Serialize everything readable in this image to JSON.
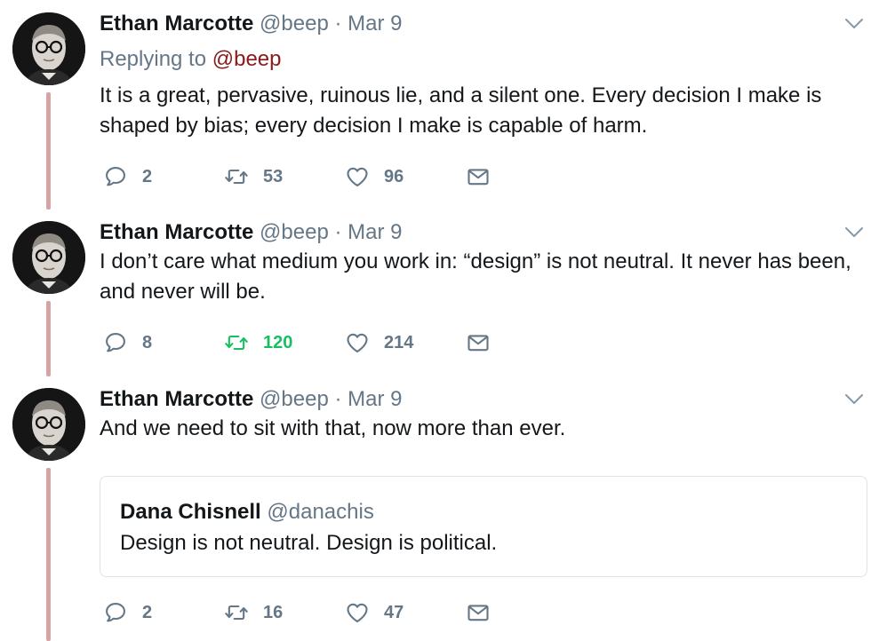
{
  "colors": {
    "text": "#14171a",
    "muted": "#657786",
    "mention": "#8b1a1a",
    "retweet_active": "#17bf63",
    "thread_line": "#d7a4a6",
    "quote_border": "#dfe3e8"
  },
  "tweets": [
    {
      "author_name": "Ethan Marcotte",
      "author_handle": "@beep",
      "separator": "·",
      "date": "Mar 9",
      "replying_prefix": "Replying to",
      "replying_mention": "@beep",
      "text": "It is a great, pervasive, ruinous lie, and a silent one. Every decision I make is shaped by bias; every decision I make is capable of harm.",
      "replies": "2",
      "retweets": "53",
      "retweeted": false,
      "likes": "96",
      "icons": [
        "reply-icon",
        "retweet-icon",
        "heart-icon",
        "mail-icon",
        "chevron-down-icon"
      ]
    },
    {
      "author_name": "Ethan Marcotte",
      "author_handle": "@beep",
      "separator": "·",
      "date": "Mar 9",
      "text": "I don’t care what medium you work in: “design” is not neutral. It never has been, and never will be.",
      "replies": "8",
      "retweets": "120",
      "retweeted": true,
      "likes": "214",
      "icons": [
        "reply-icon",
        "retweet-icon",
        "heart-icon",
        "mail-icon",
        "chevron-down-icon"
      ]
    },
    {
      "author_name": "Ethan Marcotte",
      "author_handle": "@beep",
      "separator": "·",
      "date": "Mar 9",
      "text": "And we need to sit with that, now more than ever.",
      "quote": {
        "author_name": "Dana Chisnell",
        "author_handle": "@danachis",
        "text": "Design is not neutral. Design is political."
      },
      "replies": "2",
      "retweets": "16",
      "retweeted": false,
      "likes": "47",
      "icons": [
        "reply-icon",
        "retweet-icon",
        "heart-icon",
        "mail-icon",
        "chevron-down-icon"
      ]
    }
  ]
}
